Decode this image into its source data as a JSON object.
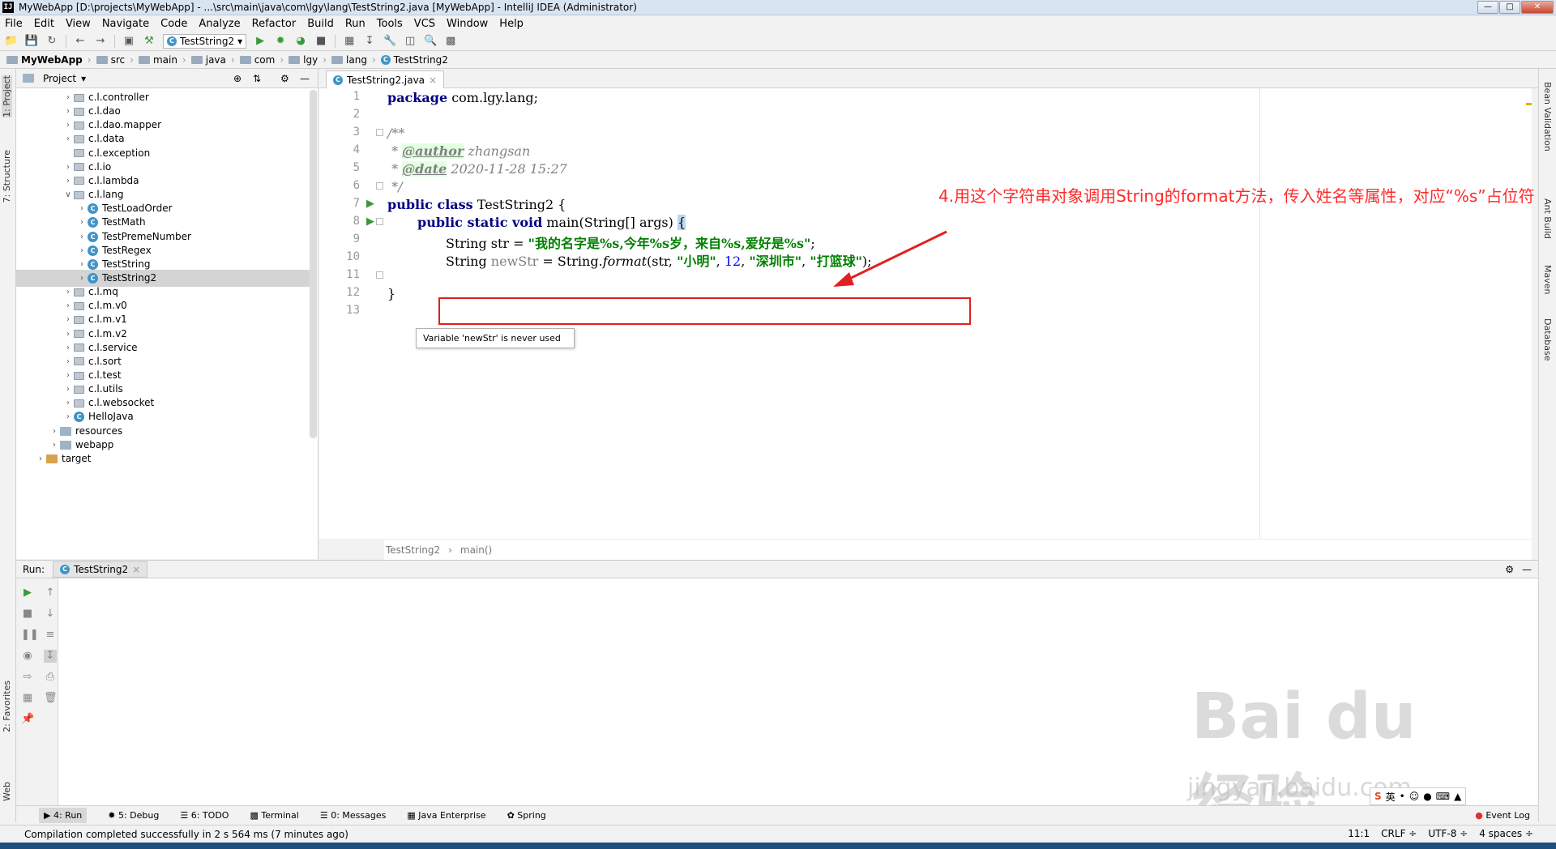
{
  "window": {
    "title": "MyWebApp [D:\\projects\\MyWebApp] - ...\\src\\main\\java\\com\\lgy\\lang\\TestString2.java [MyWebApp] - IntelliJ IDEA (Administrator)",
    "ij_logo": "IJ"
  },
  "menu": [
    "File",
    "Edit",
    "View",
    "Navigate",
    "Code",
    "Analyze",
    "Refactor",
    "Build",
    "Run",
    "Tools",
    "VCS",
    "Window",
    "Help"
  ],
  "toolbar": {
    "run_config": "TestString2"
  },
  "breadcrumb": {
    "project": "MyWebApp",
    "items": [
      "src",
      "main",
      "java",
      "com",
      "lgy",
      "lang"
    ],
    "file": "TestString2"
  },
  "left_tabs": {
    "project": "1: Project",
    "structure": "7: Structure",
    "favorites": "2: Favorites",
    "web": "Web"
  },
  "right_tabs": {
    "bean": "Bean Validation",
    "ant": "Ant Build",
    "maven": "Maven",
    "database": "Database"
  },
  "project_panel": {
    "header": "Project",
    "tree": [
      {
        "label": "c.l.controller",
        "indent": 3,
        "type": "pkg",
        "arrow": true
      },
      {
        "label": "c.l.dao",
        "indent": 3,
        "type": "pkg",
        "arrow": true
      },
      {
        "label": "c.l.dao.mapper",
        "indent": 3,
        "type": "pkg",
        "arrow": true
      },
      {
        "label": "c.l.data",
        "indent": 3,
        "type": "pkg",
        "arrow": true
      },
      {
        "label": "c.l.exception",
        "indent": 3,
        "type": "pkg",
        "arrow": false
      },
      {
        "label": "c.l.io",
        "indent": 3,
        "type": "pkg",
        "arrow": true
      },
      {
        "label": "c.l.lambda",
        "indent": 3,
        "type": "pkg",
        "arrow": true
      },
      {
        "label": "c.l.lang",
        "indent": 3,
        "type": "pkg",
        "arrow": "open"
      },
      {
        "label": "TestLoadOrder",
        "indent": 4,
        "type": "class",
        "arrow": true
      },
      {
        "label": "TestMath",
        "indent": 4,
        "type": "class",
        "arrow": true
      },
      {
        "label": "TestPremeNumber",
        "indent": 4,
        "type": "class",
        "arrow": true
      },
      {
        "label": "TestRegex",
        "indent": 4,
        "type": "class",
        "arrow": true
      },
      {
        "label": "TestString",
        "indent": 4,
        "type": "class",
        "arrow": true
      },
      {
        "label": "TestString2",
        "indent": 4,
        "type": "class",
        "arrow": true,
        "selected": true
      },
      {
        "label": "c.l.mq",
        "indent": 3,
        "type": "pkg",
        "arrow": true
      },
      {
        "label": "c.l.m.v0",
        "indent": 3,
        "type": "pkg",
        "arrow": true
      },
      {
        "label": "c.l.m.v1",
        "indent": 3,
        "type": "pkg",
        "arrow": true
      },
      {
        "label": "c.l.m.v2",
        "indent": 3,
        "type": "pkg",
        "arrow": true
      },
      {
        "label": "c.l.service",
        "indent": 3,
        "type": "pkg",
        "arrow": true
      },
      {
        "label": "c.l.sort",
        "indent": 3,
        "type": "pkg",
        "arrow": true
      },
      {
        "label": "c.l.test",
        "indent": 3,
        "type": "pkg",
        "arrow": true
      },
      {
        "label": "c.l.utils",
        "indent": 3,
        "type": "pkg",
        "arrow": true
      },
      {
        "label": "c.l.websocket",
        "indent": 3,
        "type": "pkg",
        "arrow": true
      },
      {
        "label": "HelloJava",
        "indent": 3,
        "type": "class",
        "arrow": true
      },
      {
        "label": "resources",
        "indent": 2,
        "type": "folder",
        "arrow": true
      },
      {
        "label": "webapp",
        "indent": 2,
        "type": "folder",
        "arrow": true
      },
      {
        "label": "target",
        "indent": 1,
        "type": "folder-orange",
        "arrow": true
      }
    ]
  },
  "editor": {
    "tab": "TestString2.java",
    "line_numbers": [
      "1",
      "2",
      "3",
      "4",
      "5",
      "6",
      "7",
      "8",
      "9",
      "10",
      "11",
      "12",
      "13"
    ],
    "code": {
      "l1_kw": "package",
      "l1_rest": " com.lgy.lang;",
      "l3": "/**",
      "l4_star": " * ",
      "l4_tag": "@author",
      "l4_rest": " zhangsan",
      "l5_star": " * ",
      "l5_tag": "@date",
      "l5_rest": " 2020-11-28 15:27",
      "l6": " */",
      "l7_kw": "public class",
      "l7_rest": " TestString2 {",
      "l8_kw": "public static void",
      "l8_rest": " main(String[] args) ",
      "l8_brace": "{",
      "l9_pre": "String str = ",
      "l9_str": "\"我的名字是%s,今年%s岁，来自%s,爱好是%s\"",
      "l9_end": ";",
      "l10_type": "String ",
      "l10_var": "newStr",
      "l10_mid": " = String.",
      "l10_method": "format",
      "l10_args1": "(str, ",
      "l10_s1": "\"小明\"",
      "l10_comma1": ", ",
      "l10_num": "12",
      "l10_comma2": ", ",
      "l10_s2": "\"深圳市\"",
      "l10_comma3": ", ",
      "l10_s3": "\"打篮球\"",
      "l10_end": ");",
      "l12": "}"
    },
    "tooltip": "Variable 'newStr' is never used",
    "annotation": "4.用这个字符串对象调用String的format方法，传入姓名等属性，对应“%s”占位符",
    "bottom_crumbs": [
      "TestString2",
      "main()"
    ]
  },
  "run_panel": {
    "label": "Run:",
    "tab": "TestString2"
  },
  "tool_windows": [
    "4: Run",
    "5: Debug",
    "6: TODO",
    "Terminal",
    "0: Messages",
    "Java Enterprise",
    "Spring"
  ],
  "event_log": "Event Log",
  "status": {
    "message": "Compilation completed successfully in 2 s 564 ms (7 minutes ago)",
    "position": "11:1",
    "line_sep": "CRLF ÷",
    "encoding": "UTF-8 ÷",
    "indent": "4 spaces ÷"
  },
  "watermark": {
    "main": "Bai du 经验",
    "sub": "jingyan.baidu.com"
  },
  "ime": "英",
  "colors": {
    "annotation_red": "#e02020",
    "keyword": "#000080",
    "string": "#008000",
    "current_line": "#fffae3"
  }
}
